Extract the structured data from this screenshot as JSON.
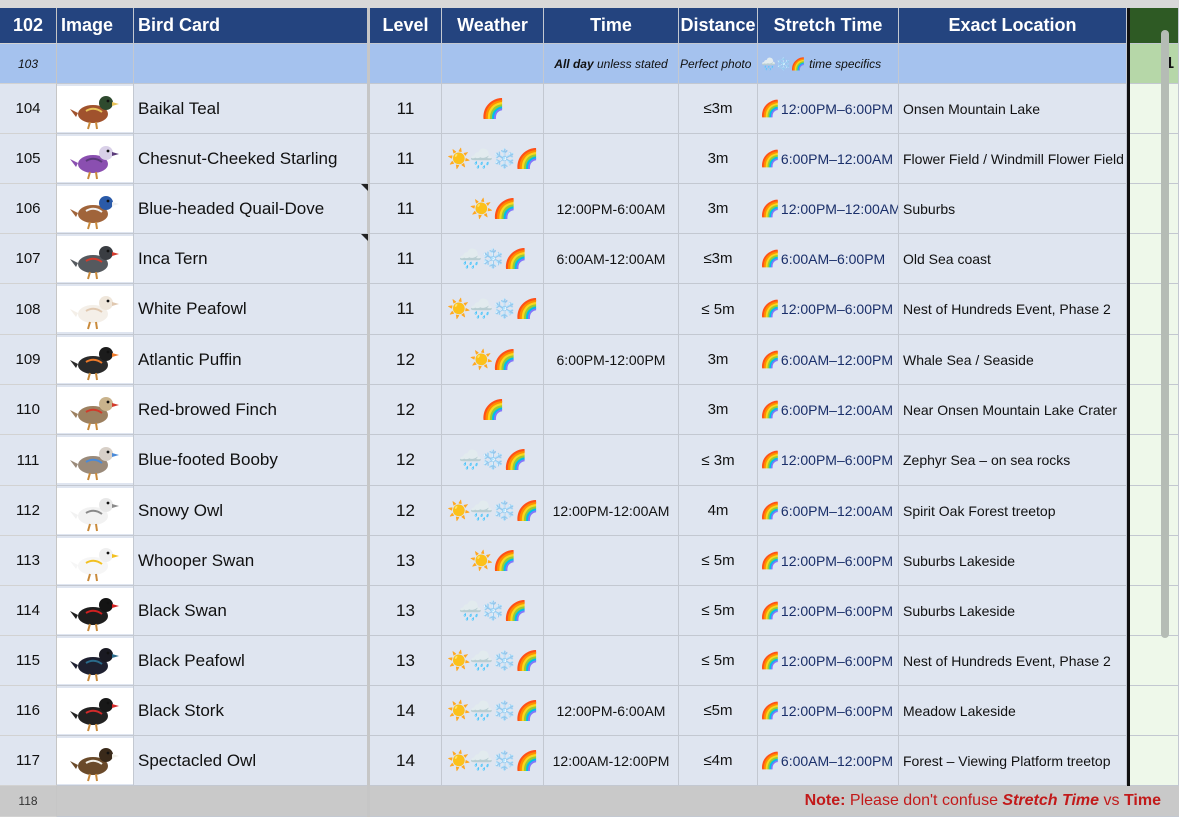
{
  "columns": {
    "image": "Image",
    "bird_card": "Bird Card",
    "level": "Level",
    "weather": "Weather",
    "time": "Time",
    "distance": "Distance",
    "stretch_time": "Stretch Time",
    "exact_location": "Exact Location"
  },
  "subheader": {
    "row_number": "103",
    "time_note_bold": "All day",
    "time_note_rest": " unless stated",
    "distance_note": "Perfect photo",
    "stretch_note_icons": "🌧️❄️🌈",
    "stretch_note_text": " time specifics",
    "extra_value": "1"
  },
  "header_row_number": "102",
  "rows": [
    {
      "row_number": "104",
      "bird": "Baikal Teal",
      "level": "11",
      "weather": "🌈",
      "time": "",
      "distance": "≤3m",
      "stretch_icon": "🌈",
      "stretch": "12:00PM–6:00PM",
      "location": "Onsen Mountain Lake",
      "image_icon": "baikal-teal-icon"
    },
    {
      "row_number": "105",
      "bird": "Chesnut-Cheeked Starling",
      "level": "11",
      "weather": "☀️🌧️❄️🌈",
      "time": "",
      "distance": "3m",
      "stretch_icon": "🌈",
      "stretch": "6:00PM–12:00AM",
      "location": "Flower Field / Windmill Flower Field",
      "image_icon": "starling-icon"
    },
    {
      "row_number": "106",
      "bird": "Blue-headed Quail-Dove",
      "level": "11",
      "weather": "☀️🌈",
      "time": "12:00PM-6:00AM",
      "distance": "3m",
      "stretch_icon": "🌈",
      "stretch": "12:00PM–12:00AM",
      "location": "Suburbs",
      "image_icon": "quail-dove-icon"
    },
    {
      "row_number": "107",
      "bird": "Inca Tern",
      "level": "11",
      "weather": "🌧️❄️🌈",
      "time": "6:00AM-12:00AM",
      "distance": "≤3m",
      "stretch_icon": "🌈",
      "stretch": "6:00AM–6:00PM",
      "location": "Old Sea coast",
      "image_icon": "inca-tern-icon"
    },
    {
      "row_number": "108",
      "bird": "White Peafowl",
      "level": "11",
      "weather": "☀️🌧️❄️🌈",
      "time": "",
      "distance": "≤ 5m",
      "stretch_icon": "🌈",
      "stretch": "12:00PM–6:00PM",
      "location": "Nest of Hundreds Event, Phase 2",
      "image_icon": "white-peafowl-icon"
    },
    {
      "row_number": "109",
      "bird": "Atlantic Puffin",
      "level": "12",
      "weather": "☀️🌈",
      "time": "6:00PM-12:00PM",
      "distance": "3m",
      "stretch_icon": "🌈",
      "stretch": "6:00AM–12:00PM",
      "location": "Whale Sea / Seaside",
      "image_icon": "puffin-icon"
    },
    {
      "row_number": "110",
      "bird": "Red-browed Finch",
      "level": "12",
      "weather": "🌈",
      "time": "",
      "distance": "3m",
      "stretch_icon": "🌈",
      "stretch": "6:00PM–12:00AM",
      "location": "Near Onsen Mountain Lake Crater",
      "image_icon": "finch-icon"
    },
    {
      "row_number": "111",
      "bird": "Blue-footed Booby",
      "level": "12",
      "weather": "🌧️❄️🌈",
      "time": "",
      "distance": "≤ 3m",
      "stretch_icon": "🌈",
      "stretch": "12:00PM–6:00PM",
      "location": "Zephyr Sea – on sea rocks",
      "image_icon": "booby-icon"
    },
    {
      "row_number": "112",
      "bird": "Snowy Owl",
      "level": "12",
      "weather": "☀️🌧️❄️🌈",
      "time": "12:00PM-12:00AM",
      "distance": "4m",
      "stretch_icon": "🌈",
      "stretch": "6:00PM–12:00AM",
      "location": "Spirit Oak Forest treetop",
      "image_icon": "snowy-owl-icon"
    },
    {
      "row_number": "113",
      "bird": "Whooper Swan",
      "level": "13",
      "weather": "☀️🌈",
      "time": "",
      "distance": "≤ 5m",
      "stretch_icon": "🌈",
      "stretch": "12:00PM–6:00PM",
      "location": "Suburbs Lakeside",
      "image_icon": "whooper-swan-icon"
    },
    {
      "row_number": "114",
      "bird": "Black Swan",
      "level": "13",
      "weather": "🌧️❄️🌈",
      "time": "",
      "distance": "≤ 5m",
      "stretch_icon": "🌈",
      "stretch": "12:00PM–6:00PM",
      "location": "Suburbs Lakeside",
      "image_icon": "black-swan-icon"
    },
    {
      "row_number": "115",
      "bird": "Black Peafowl",
      "level": "13",
      "weather": "☀️🌧️❄️🌈",
      "time": "",
      "distance": "≤ 5m",
      "stretch_icon": "🌈",
      "stretch": "12:00PM–6:00PM",
      "location": "Nest of Hundreds Event, Phase 2",
      "image_icon": "black-peafowl-icon"
    },
    {
      "row_number": "116",
      "bird": "Black Stork",
      "level": "14",
      "weather": "☀️🌧️❄️🌈",
      "time": "12:00PM-6:00AM",
      "distance": "≤5m",
      "stretch_icon": "🌈",
      "stretch": "12:00PM–6:00PM",
      "location": "Meadow Lakeside",
      "image_icon": "black-stork-icon"
    },
    {
      "row_number": "117",
      "bird": "Spectacled Owl",
      "level": "14",
      "weather": "☀️🌧️❄️🌈",
      "time": "12:00AM-12:00PM",
      "distance": "≤4m",
      "stretch_icon": "🌈",
      "stretch": "6:00AM–12:00PM",
      "location": "Forest – Viewing Platform treetop",
      "image_icon": "spectacled-owl-icon"
    }
  ],
  "footer": {
    "row_number": "118",
    "note_label": "Note:",
    "note_text": " Please don't confuse ",
    "note_term1": "Stretch Time",
    "note_vs": " vs ",
    "note_term2": "Time"
  },
  "colors": {
    "header_bg": "#24447f",
    "subheader_bg": "#a5c2ee",
    "row_bg": "#dfe5f0",
    "note_red": "#c21a1a",
    "extra_header_green": "#2e5a24"
  },
  "bird_colors": [
    {
      "body": "#a0522d",
      "head": "#2e4a2e",
      "accent": "#e8c45a"
    },
    {
      "body": "#8a4fb0",
      "head": "#d9d0e8",
      "accent": "#5a3a7a"
    },
    {
      "body": "#a0643a",
      "head": "#2a5aa8",
      "accent": "#f0f0f0"
    },
    {
      "body": "#55595e",
      "head": "#3a3d42",
      "accent": "#d33a2c"
    },
    {
      "body": "#f4efe8",
      "head": "#efe6da",
      "accent": "#e0c8b0"
    },
    {
      "body": "#2a2a2a",
      "head": "#1c1c1c",
      "accent": "#ee7a2a"
    },
    {
      "body": "#9c8060",
      "head": "#c9b38c",
      "accent": "#d23a2a"
    },
    {
      "body": "#9a8a7a",
      "head": "#d8d0c8",
      "accent": "#4a8ad8"
    },
    {
      "body": "#f2f2f2",
      "head": "#e8e8e8",
      "accent": "#8a8a8a"
    },
    {
      "body": "#f6f6f6",
      "head": "#f0f0f0",
      "accent": "#f2c020"
    },
    {
      "body": "#1e1e1e",
      "head": "#141414",
      "accent": "#d02020"
    },
    {
      "body": "#1e2030",
      "head": "#1a1a22",
      "accent": "#2a6a8a"
    },
    {
      "body": "#222222",
      "head": "#181818",
      "accent": "#d22a2a"
    },
    {
      "body": "#6a4a2a",
      "head": "#3a2a1a",
      "accent": "#f2f0e8"
    }
  ]
}
